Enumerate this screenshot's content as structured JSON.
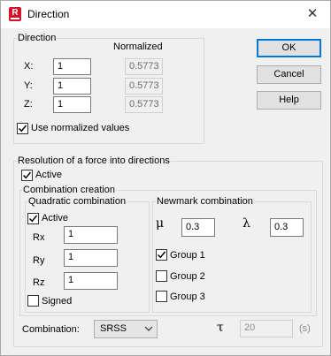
{
  "window": {
    "title": "Direction"
  },
  "direction": {
    "group_label": "Direction",
    "normalized_header": "Normalized",
    "rows": [
      {
        "label": "X:",
        "value": "1",
        "normalized": "0.5773"
      },
      {
        "label": "Y:",
        "value": "1",
        "normalized": "0.5773"
      },
      {
        "label": "Z:",
        "value": "1",
        "normalized": "0.5773"
      }
    ],
    "use_normalized": {
      "label": "Use normalized values",
      "checked": true
    }
  },
  "buttons": {
    "ok": "OK",
    "cancel": "Cancel",
    "help": "Help"
  },
  "resolution": {
    "group_label": "Resolution of a force into directions",
    "active": {
      "label": "Active",
      "checked": true
    },
    "combination_creation": {
      "group_label": "Combination creation",
      "quadratic": {
        "group_label": "Quadratic combination",
        "active": {
          "label": "Active",
          "checked": true
        },
        "rx": {
          "label": "Rx",
          "value": "1"
        },
        "ry": {
          "label": "Ry",
          "value": "1"
        },
        "rz": {
          "label": "Rz",
          "value": "1"
        },
        "signed": {
          "label": "Signed",
          "checked": false
        }
      },
      "newmark": {
        "group_label": "Newmark combination",
        "mu": {
          "symbol": "μ",
          "value": "0.3"
        },
        "lambda": {
          "symbol": "λ",
          "value": "0.3"
        },
        "groups": [
          {
            "label": "Group 1",
            "checked": true
          },
          {
            "label": "Group 2",
            "checked": false
          },
          {
            "label": "Group 3",
            "checked": false
          }
        ]
      }
    },
    "combination": {
      "label": "Combination:",
      "selected": "SRSS"
    },
    "tau": {
      "symbol": "τ",
      "value": "20",
      "unit": "(s)"
    }
  }
}
